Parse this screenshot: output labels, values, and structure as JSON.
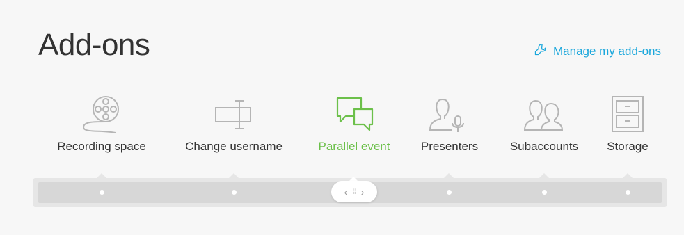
{
  "page": {
    "title": "Add-ons"
  },
  "manage_link": {
    "label": "Manage my add-ons",
    "icon": "wrench-icon",
    "color": "#1aa7dc"
  },
  "addons": [
    {
      "label": "Recording space",
      "icon": "film-reel-icon",
      "active": false
    },
    {
      "label": "Change username",
      "icon": "rename-field-icon",
      "active": false
    },
    {
      "label": "Parallel event",
      "icon": "chat-bubbles-icon",
      "active": true
    },
    {
      "label": "Presenters",
      "icon": "presenter-mic-icon",
      "active": false
    },
    {
      "label": "Subaccounts",
      "icon": "users-icon",
      "active": false
    },
    {
      "label": "Storage",
      "icon": "cabinet-icon",
      "active": false
    }
  ],
  "slider": {
    "prev_symbol": "‹",
    "next_symbol": "›",
    "grip_symbol": "⁞⁞",
    "active_index": 2
  },
  "colors": {
    "accent": "#6cc04a",
    "link": "#1aa7dc",
    "icon_gray": "#b5b5b5"
  }
}
